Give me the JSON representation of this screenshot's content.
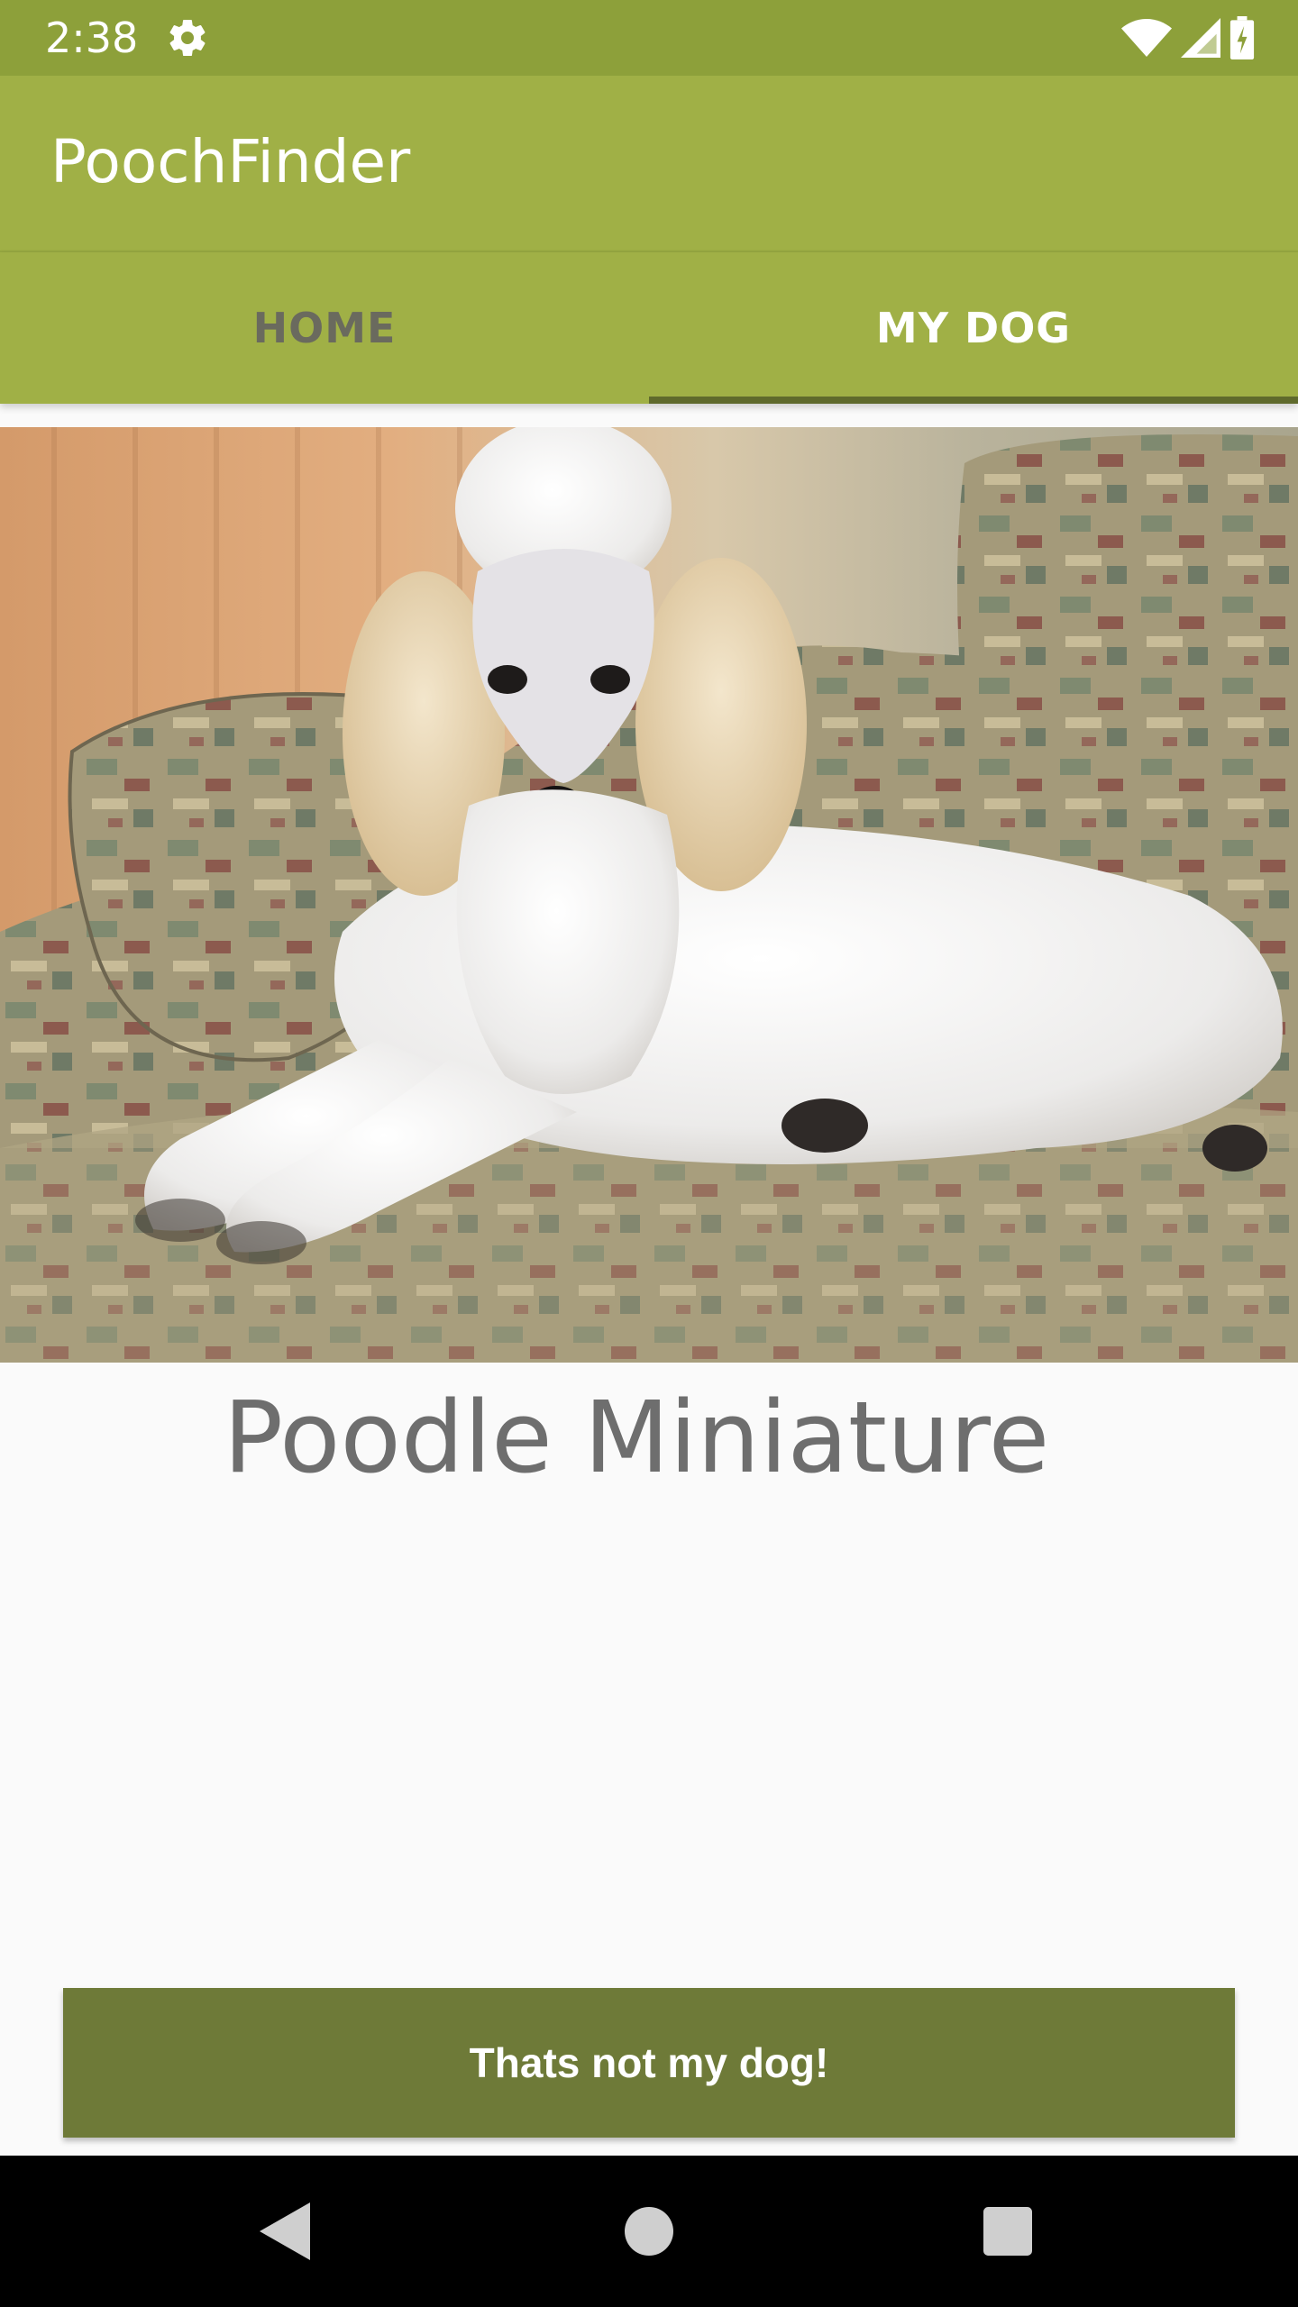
{
  "status_bar": {
    "time": "2:38",
    "icons": [
      "settings-gear-icon",
      "wifi-icon",
      "cell-signal-icon",
      "battery-icon"
    ],
    "background": "#8da03a"
  },
  "app_bar": {
    "title": "PoochFinder",
    "background": "#a0b046"
  },
  "tabs": [
    {
      "label": "HOME",
      "selected": false
    },
    {
      "label": "MY DOG",
      "selected": true
    }
  ],
  "dog": {
    "photo": "poodle-on-couch-photo",
    "breed": "Poodle Miniature"
  },
  "actions": {
    "not_my_dog_label": "Thats not my dog!",
    "button_color": "#6e7a38"
  },
  "nav_bar": {
    "buttons": [
      "back-icon",
      "home-icon",
      "recents-icon"
    ]
  }
}
